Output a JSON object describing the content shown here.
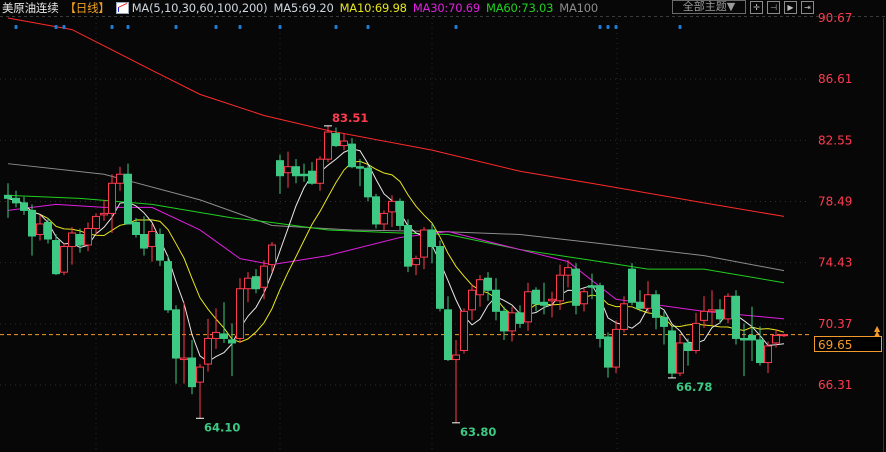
{
  "header": {
    "title": "美原油连续",
    "period": "【日线】",
    "ma_params": "MA(5,10,30,60,100,200)",
    "ma5": "MA5:69.20",
    "ma10": "MA10:69.98",
    "ma30": "MA30:70.69",
    "ma60": "MA60:73.03",
    "ma100": "MA100"
  },
  "toolbar": {
    "theme_label": "全部主题▼",
    "icons": [
      "crosshair-icon",
      "fit-range-icon",
      "play-forward-icon",
      "scroll-to-end-icon"
    ]
  },
  "current_price": "69.65",
  "colors": {
    "up": "#ff3b4f",
    "down": "#3dc983",
    "ma5": "#e8e8e8",
    "ma10": "#e6e620",
    "ma30": "#e020e0",
    "ma60": "#20d020",
    "ma100": "#8c8c8c",
    "ma200": "#ff2a2a",
    "price_line": "#f39a2c",
    "axis_label": "#ff3b4f",
    "event_marker": "#1e7fd8"
  },
  "chart_data": {
    "type": "candlestick",
    "title": "美原油连续",
    "y_ticks": [
      "90.67",
      "86.61",
      "82.55",
      "78.49",
      "74.43",
      "70.37",
      "66.31"
    ],
    "ylim": [
      61.87,
      90.67
    ],
    "grid": true,
    "candle_fields": [
      "open",
      "high",
      "low",
      "close"
    ],
    "candles": [
      [
        78.9,
        79.7,
        77.4,
        78.7
      ],
      [
        78.7,
        79.2,
        78.1,
        78.4
      ],
      [
        78.4,
        78.8,
        77.6,
        77.9
      ],
      [
        77.9,
        78.3,
        74.9,
        76.2
      ],
      [
        76.3,
        77.6,
        75.9,
        77.0
      ],
      [
        77.1,
        77.4,
        75.7,
        76.0
      ],
      [
        75.9,
        76.3,
        73.6,
        73.7
      ],
      [
        73.8,
        75.7,
        73.6,
        75.5
      ],
      [
        75.5,
        76.8,
        74.3,
        76.4
      ],
      [
        76.3,
        76.7,
        75.1,
        75.6
      ],
      [
        75.6,
        77.1,
        75.2,
        76.7
      ],
      [
        76.7,
        77.7,
        76.3,
        77.5
      ],
      [
        77.6,
        78.6,
        77.2,
        77.7
      ],
      [
        77.7,
        80.3,
        76.4,
        79.7
      ],
      [
        79.7,
        80.8,
        79.2,
        80.3
      ],
      [
        80.3,
        81.0,
        77.0,
        77.0
      ],
      [
        77.1,
        77.4,
        76.1,
        76.3
      ],
      [
        76.3,
        77.5,
        74.9,
        75.4
      ],
      [
        75.5,
        77.0,
        74.5,
        76.5
      ],
      [
        76.3,
        76.7,
        74.2,
        74.6
      ],
      [
        74.5,
        74.9,
        71.1,
        71.3
      ],
      [
        71.3,
        71.6,
        66.4,
        68.1
      ],
      [
        68.0,
        71.8,
        66.4,
        68.1
      ],
      [
        68.1,
        69.3,
        65.7,
        66.2
      ],
      [
        66.5,
        67.7,
        64.1,
        67.5
      ],
      [
        67.7,
        70.7,
        67.2,
        69.4
      ],
      [
        69.4,
        71.4,
        68.7,
        69.8
      ],
      [
        69.7,
        71.8,
        69.1,
        69.4
      ],
      [
        69.3,
        70.4,
        66.9,
        69.1
      ],
      [
        69.4,
        73.4,
        69.1,
        72.7
      ],
      [
        72.7,
        73.8,
        71.8,
        73.4
      ],
      [
        73.5,
        74.0,
        72.4,
        72.7
      ],
      [
        72.8,
        74.6,
        72.0,
        74.2
      ],
      [
        74.3,
        75.8,
        73.8,
        75.6
      ],
      [
        81.2,
        81.6,
        79.0,
        80.2
      ],
      [
        80.4,
        81.8,
        79.4,
        80.8
      ],
      [
        80.8,
        81.3,
        79.7,
        80.2
      ],
      [
        80.3,
        81.0,
        79.8,
        80.2
      ],
      [
        80.5,
        81.1,
        79.6,
        79.7
      ],
      [
        79.7,
        81.5,
        79.2,
        81.3
      ],
      [
        81.3,
        83.51,
        81.1,
        83.1
      ],
      [
        83.0,
        83.4,
        82.1,
        82.2
      ],
      [
        82.2,
        83.0,
        81.9,
        82.5
      ],
      [
        82.3,
        82.7,
        80.7,
        80.8
      ],
      [
        80.8,
        81.3,
        79.5,
        80.7
      ],
      [
        80.7,
        80.9,
        78.5,
        78.8
      ],
      [
        78.8,
        79.0,
        76.7,
        77.0
      ],
      [
        77.0,
        77.9,
        76.6,
        77.7
      ],
      [
        77.8,
        78.9,
        76.8,
        78.5
      ],
      [
        78.5,
        78.7,
        76.6,
        76.9
      ],
      [
        76.9,
        77.3,
        73.8,
        74.2
      ],
      [
        74.3,
        74.9,
        73.6,
        74.7
      ],
      [
        74.8,
        76.8,
        74.0,
        76.6
      ],
      [
        76.6,
        77.0,
        74.4,
        75.5
      ],
      [
        75.5,
        75.9,
        71.2,
        71.4
      ],
      [
        71.3,
        72.2,
        67.9,
        68.0
      ],
      [
        68.0,
        69.3,
        63.8,
        68.3
      ],
      [
        68.6,
        71.4,
        68.4,
        71.2
      ],
      [
        71.3,
        73.0,
        70.6,
        72.6
      ],
      [
        72.3,
        73.6,
        71.5,
        73.3
      ],
      [
        73.4,
        73.8,
        71.9,
        72.6
      ],
      [
        72.6,
        73.4,
        70.6,
        71.2
      ],
      [
        71.2,
        71.5,
        69.3,
        69.9
      ],
      [
        69.9,
        71.5,
        69.2,
        71.1
      ],
      [
        71.1,
        71.6,
        70.1,
        70.4
      ],
      [
        70.5,
        73.1,
        69.9,
        72.5
      ],
      [
        72.6,
        72.8,
        71.2,
        71.7
      ],
      [
        71.8,
        73.1,
        71.0,
        71.6
      ],
      [
        71.9,
        72.5,
        70.8,
        72.0
      ],
      [
        71.9,
        74.3,
        71.3,
        73.6
      ],
      [
        73.6,
        74.6,
        72.8,
        74.1
      ],
      [
        74.0,
        74.4,
        71.0,
        71.6
      ],
      [
        71.7,
        72.7,
        71.2,
        72.5
      ],
      [
        72.9,
        73.7,
        72.0,
        72.8
      ],
      [
        72.9,
        73.1,
        68.8,
        69.4
      ],
      [
        69.5,
        69.8,
        66.8,
        67.5
      ],
      [
        67.5,
        70.6,
        67.1,
        70.0
      ],
      [
        70.0,
        72.2,
        69.8,
        71.7
      ],
      [
        74.0,
        74.4,
        71.6,
        71.8
      ],
      [
        71.8,
        72.6,
        71.2,
        71.4
      ],
      [
        71.4,
        73.2,
        71.1,
        72.3
      ],
      [
        72.3,
        72.6,
        70.0,
        70.8
      ],
      [
        70.8,
        71.2,
        69.0,
        70.2
      ],
      [
        69.9,
        70.2,
        66.78,
        67.1
      ],
      [
        67.1,
        69.6,
        66.9,
        69.1
      ],
      [
        69.1,
        69.4,
        67.6,
        68.6
      ],
      [
        68.6,
        71.1,
        68.4,
        70.4
      ],
      [
        70.6,
        72.2,
        70.1,
        71.2
      ],
      [
        71.2,
        72.6,
        70.3,
        71.3
      ],
      [
        71.3,
        72.0,
        70.4,
        70.7
      ],
      [
        70.7,
        72.4,
        70.4,
        72.2
      ],
      [
        72.2,
        72.6,
        69.0,
        69.4
      ],
      [
        69.4,
        70.4,
        66.9,
        69.3
      ],
      [
        69.6,
        71.5,
        67.9,
        69.3
      ],
      [
        69.3,
        70.2,
        67.6,
        67.8
      ],
      [
        67.8,
        69.2,
        67.1,
        68.9
      ],
      [
        69.1,
        70.0,
        68.8,
        69.6
      ],
      [
        69.6,
        69.7,
        69.5,
        69.65
      ]
    ],
    "moving_averages": {
      "MA30": [
        [
          0,
          77.9
        ],
        [
          6,
          78.3
        ],
        [
          12,
          78.1
        ],
        [
          18,
          78.1
        ],
        [
          24,
          76.6
        ],
        [
          29,
          74.7
        ],
        [
          33,
          74.3
        ],
        [
          40,
          74.9
        ],
        [
          49,
          76.1
        ],
        [
          55,
          76.5
        ],
        [
          64,
          75.3
        ],
        [
          70,
          74.5
        ],
        [
          76,
          72.0
        ],
        [
          87,
          71.2
        ],
        [
          97,
          70.7
        ]
      ],
      "MA60": [
        [
          0,
          78.9
        ],
        [
          9,
          78.7
        ],
        [
          18,
          78.3
        ],
        [
          28,
          77.4
        ],
        [
          33,
          77.1
        ],
        [
          40,
          76.6
        ],
        [
          49,
          76.4
        ],
        [
          55,
          76.3
        ],
        [
          64,
          75.3
        ],
        [
          74,
          74.5
        ],
        [
          80,
          74.0
        ],
        [
          87,
          74.0
        ],
        [
          97,
          73.1
        ]
      ],
      "MA100": [
        [
          0,
          81.0
        ],
        [
          12,
          80.3
        ],
        [
          24,
          78.6
        ],
        [
          33,
          76.9
        ],
        [
          43,
          76.6
        ],
        [
          54,
          76.5
        ],
        [
          64,
          76.3
        ],
        [
          74,
          75.7
        ],
        [
          87,
          74.9
        ],
        [
          97,
          73.9
        ]
      ],
      "MA200": [
        [
          0,
          90.67
        ],
        [
          8,
          89.9
        ],
        [
          18,
          87.2
        ],
        [
          24,
          85.6
        ],
        [
          32,
          84.2
        ],
        [
          40,
          83.2
        ],
        [
          53,
          81.9
        ],
        [
          64,
          80.5
        ],
        [
          74,
          79.6
        ],
        [
          87,
          78.4
        ],
        [
          97,
          77.5
        ]
      ]
    },
    "annotations": [
      {
        "label": "83.51",
        "candle": 40,
        "type": "high"
      },
      {
        "label": "64.10",
        "candle": 24,
        "type": "low"
      },
      {
        "label": "63.80",
        "candle": 56,
        "type": "low"
      },
      {
        "label": "66.78",
        "candle": 83,
        "type": "low"
      }
    ],
    "event_markers": [
      1,
      6,
      7,
      13,
      15,
      21,
      26,
      29,
      34,
      41,
      45,
      56,
      74,
      75,
      76,
      84
    ]
  }
}
